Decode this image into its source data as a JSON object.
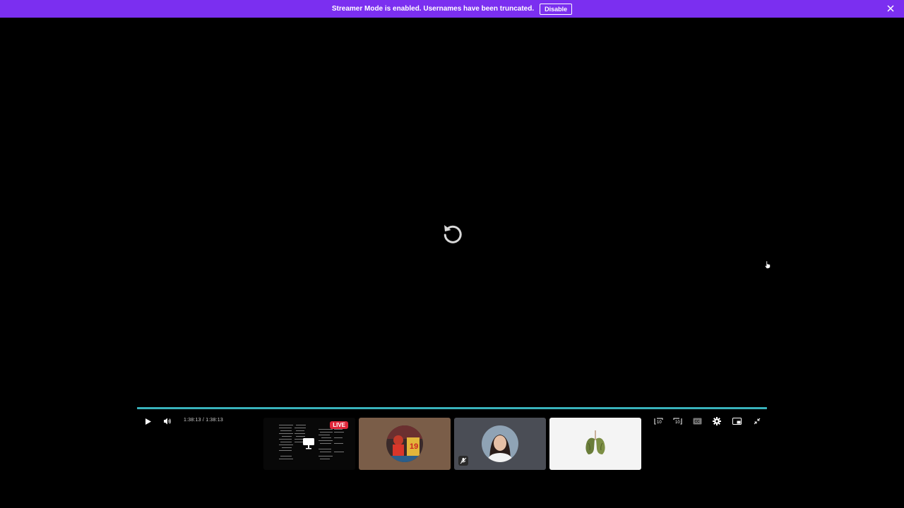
{
  "banner": {
    "message": "Streamer Mode is enabled. Usernames have been truncated.",
    "disable_label": "Disable",
    "background_color": "#7b2ff0"
  },
  "player": {
    "state": "ended",
    "progress_percent": 100,
    "time_display": "1:38:13 / 1:38:13",
    "accent_color": "#2a9aa3",
    "icons": {
      "replay": "replay-icon",
      "play": "play-icon",
      "volume": "volume-icon",
      "rewind": "rewind-10-icon",
      "forward": "forward-10-icon",
      "captions": "captions-icon",
      "settings": "gear-icon",
      "pip": "picture-in-picture-icon",
      "fullscreen": "exit-fullscreen-icon"
    }
  },
  "thumbnails": [
    {
      "type": "live-stream",
      "badge": "LIVE"
    },
    {
      "type": "avatar-soccer"
    },
    {
      "type": "avatar-portrait",
      "icon": "mic-muted-icon"
    },
    {
      "type": "avatar-lungs"
    }
  ]
}
